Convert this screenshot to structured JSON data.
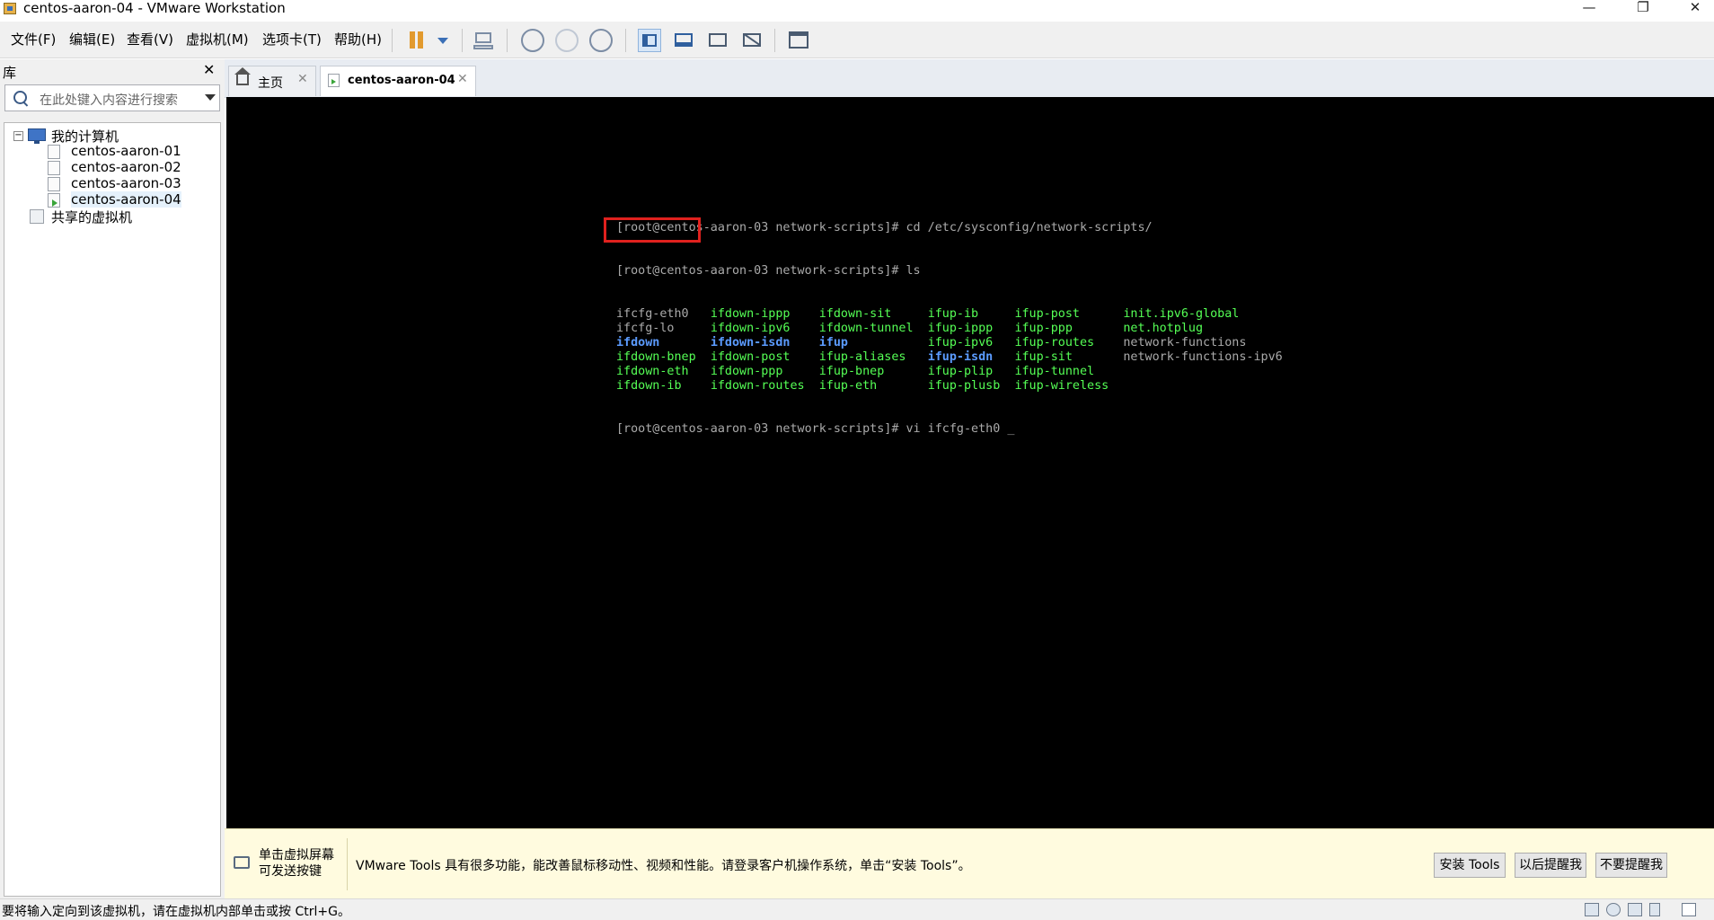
{
  "window": {
    "title": "centos-aaron-04 - VMware Workstation",
    "minimize": "—",
    "restore": "❐",
    "close": "✕"
  },
  "menu": {
    "items": [
      "文件(F)",
      "编辑(E)",
      "查看(V)",
      "虚拟机(M)",
      "选项卡(T)",
      "帮助(H)"
    ]
  },
  "toolbar": {
    "icons": [
      "pause-icon",
      "dropdown-arrow-icon",
      "send-ctrl-alt-del-icon",
      "snapshot-icon",
      "revert-snapshot-icon",
      "snapshot-manager-icon",
      "show-library-icon",
      "thumbnail-bar-icon",
      "full-screen-icon",
      "unity-icon",
      "console-view-icon"
    ]
  },
  "library": {
    "title": "库",
    "close": "✕",
    "search_placeholder": "在此处键入内容进行搜索",
    "tree": {
      "expander": "−",
      "root": "我的计算机",
      "vms": [
        "centos-aaron-01",
        "centos-aaron-02",
        "centos-aaron-03",
        "centos-aaron-04"
      ],
      "selected": "centos-aaron-04",
      "shared": "共享的虚拟机"
    }
  },
  "tabs": [
    {
      "label": "主页",
      "close": "✕"
    },
    {
      "label": "centos-aaron-04",
      "close": "✕",
      "active": true
    }
  ],
  "terminal": {
    "prompt1": "[root@centos-aaron-03 network-scripts]# cd /etc/sysconfig/network-scripts/",
    "prompt2": "[root@centos-aaron-03 network-scripts]# ls",
    "rows": [
      [
        {
          "t": "ifcfg-eth0",
          "c": "gray"
        },
        {
          "t": "ifdown-ippp",
          "c": "green"
        },
        {
          "t": "ifdown-sit",
          "c": "green"
        },
        {
          "t": "ifup-ib",
          "c": "green"
        },
        {
          "t": "ifup-post",
          "c": "green"
        },
        {
          "t": "init.ipv6-global",
          "c": "green"
        }
      ],
      [
        {
          "t": "ifcfg-lo",
          "c": "gray"
        },
        {
          "t": "ifdown-ipv6",
          "c": "green"
        },
        {
          "t": "ifdown-tunnel",
          "c": "green"
        },
        {
          "t": "ifup-ippp",
          "c": "green"
        },
        {
          "t": "ifup-ppp",
          "c": "green"
        },
        {
          "t": "net.hotplug",
          "c": "green"
        }
      ],
      [
        {
          "t": "ifdown",
          "c": "blue"
        },
        {
          "t": "ifdown-isdn",
          "c": "blue"
        },
        {
          "t": "ifup",
          "c": "blue"
        },
        {
          "t": "ifup-ipv6",
          "c": "green"
        },
        {
          "t": "ifup-routes",
          "c": "green"
        },
        {
          "t": "network-functions",
          "c": "gray"
        }
      ],
      [
        {
          "t": "ifdown-bnep",
          "c": "green"
        },
        {
          "t": "ifdown-post",
          "c": "green"
        },
        {
          "t": "ifup-aliases",
          "c": "green"
        },
        {
          "t": "ifup-isdn",
          "c": "blue"
        },
        {
          "t": "ifup-sit",
          "c": "green"
        },
        {
          "t": "network-functions-ipv6",
          "c": "gray"
        }
      ],
      [
        {
          "t": "ifdown-eth",
          "c": "green"
        },
        {
          "t": "ifdown-ppp",
          "c": "green"
        },
        {
          "t": "ifup-bnep",
          "c": "green"
        },
        {
          "t": "ifup-plip",
          "c": "green"
        },
        {
          "t": "ifup-tunnel",
          "c": "green"
        },
        {
          "t": "",
          "c": "gray"
        }
      ],
      [
        {
          "t": "ifdown-ib",
          "c": "green"
        },
        {
          "t": "ifdown-routes",
          "c": "green"
        },
        {
          "t": "ifup-eth",
          "c": "green"
        },
        {
          "t": "ifup-plusb",
          "c": "green"
        },
        {
          "t": "ifup-wireless",
          "c": "green"
        },
        {
          "t": "",
          "c": "gray"
        }
      ]
    ],
    "prompt3": "[root@centos-aaron-03 network-scripts]# vi ifcfg-eth0 _",
    "highlighted_file": "ifcfg-eth0",
    "colors": {
      "gray": "#aaaaaa",
      "green": "#55ff55",
      "blue": "#5b9bff",
      "highlight_box": "#e0211e"
    }
  },
  "tools_bar": {
    "hint_line1": "单击虚拟屏幕",
    "hint_line2": "可发送按键",
    "message": "VMware Tools 具有很多功能，能改善鼠标移动性、视频和性能。请登录客户机操作系统，单击“安装 Tools”。",
    "install_button": "安装 Tools",
    "remind_later_button": "以后提醒我",
    "never_remind_button": "不要提醒我"
  },
  "status_bar": {
    "text": "要将输入定向到该虚拟机，请在虚拟机内部单击或按 Ctrl+G。",
    "icons": [
      "hard-disk-icon",
      "cd-dvd-icon",
      "network-adapter-icon",
      "usb-icon",
      "message-log-icon"
    ]
  }
}
